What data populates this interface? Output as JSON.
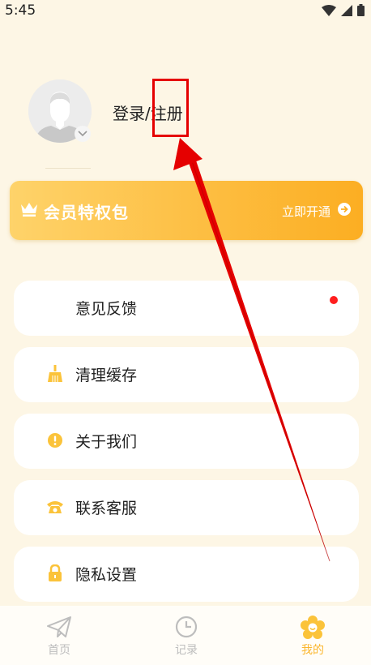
{
  "status_bar": {
    "time": "5:45"
  },
  "profile": {
    "login_label": "登录/注册"
  },
  "vip": {
    "title": "会员特权包",
    "action_label": "立即开通"
  },
  "menu": [
    {
      "label": "意见反馈",
      "icon": "feedback-icon",
      "has_red_dot": true
    },
    {
      "label": "清理缓存",
      "icon": "broom-icon"
    },
    {
      "label": "关于我们",
      "icon": "info-icon"
    },
    {
      "label": "联系客服",
      "icon": "phone-icon"
    },
    {
      "label": "隐私设置",
      "icon": "lock-icon"
    }
  ],
  "tabs": [
    {
      "label": "首页",
      "icon": "paper-plane-icon",
      "active": false
    },
    {
      "label": "记录",
      "icon": "clock-icon",
      "active": false
    },
    {
      "label": "我的",
      "icon": "smile-flower-icon",
      "active": true
    }
  ],
  "colors": {
    "accent": "#fbb62c",
    "background": "#fdf6e5",
    "annotation": "#e50000",
    "notification_dot": "#ff1e1e"
  }
}
